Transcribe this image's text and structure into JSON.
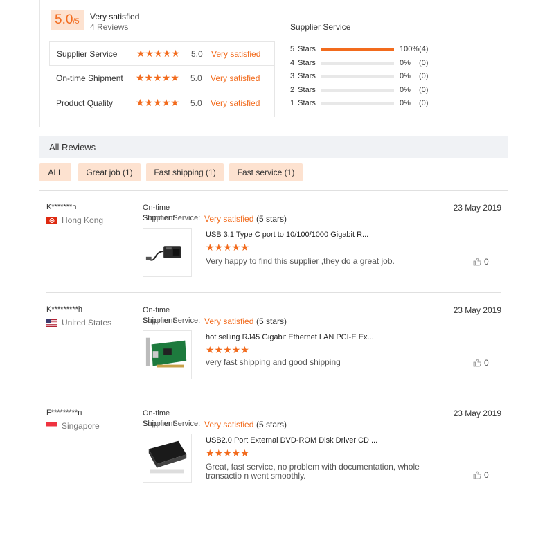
{
  "summary": {
    "score": "5.0",
    "score_max": "/5",
    "label": "Very satisfied",
    "count": "4 Reviews",
    "ratings": [
      {
        "name": "Supplier Service",
        "stars": "★★★★★",
        "value": "5.0",
        "word": "Very satisfied"
      },
      {
        "name": "On-time Shipment",
        "stars": "★★★★★",
        "value": "5.0",
        "word": "Very satisfied"
      },
      {
        "name": "Product Quality",
        "stars": "★★★★★",
        "value": "5.0",
        "word": "Very satisfied"
      }
    ],
    "distribution_title": "Supplier Service",
    "distribution": [
      {
        "label": "5 Stars",
        "fraction": 1.0,
        "pct": "100%",
        "count": "(4)"
      },
      {
        "label": "4 Stars",
        "fraction": 0.0,
        "pct": "0%",
        "count": "(0)"
      },
      {
        "label": "3 Stars",
        "fraction": 0.0,
        "pct": "0%",
        "count": "(0)"
      },
      {
        "label": "2 Stars",
        "fraction": 0.0,
        "pct": "0%",
        "count": "(0)"
      },
      {
        "label": "1 Stars",
        "fraction": 0.0,
        "pct": "0%",
        "count": "(0)"
      }
    ]
  },
  "all_reviews_title": "All Reviews",
  "filters": [
    "ALL",
    "Great job (1)",
    "Fast shipping (1)",
    "Fast service (1)"
  ],
  "reviews": [
    {
      "name": "K*******n",
      "country": "Hong Kong",
      "category_line1": "On-time",
      "category_line2": "Shipment",
      "category_overlap": "Supplier Service:",
      "rating_word": "Very satisfied",
      "rating_stars": "(5 stars)",
      "date": "23 May 2019",
      "product": "USB 3.1 Type C port to 10/100/1000 Gigabit R...",
      "stars": "★★★★★",
      "text": "Very happy to find this supplier ,they do a great job.",
      "likes": "0"
    },
    {
      "name": "K*********h",
      "country": "United States",
      "category_line1": "On-time",
      "category_line2": "Shipment",
      "category_overlap": "Supplier Service:",
      "rating_word": "Very satisfied",
      "rating_stars": "(5 stars)",
      "date": "23 May 2019",
      "product": "hot selling RJ45 Gigabit Ethernet LAN PCI-E Ex...",
      "stars": "★★★★★",
      "text": "very fast shipping and good shipping",
      "likes": "0"
    },
    {
      "name": "F*********n",
      "country": "Singapore",
      "category_line1": "On-time",
      "category_line2": "Shipment",
      "category_overlap": "Supplier Service:",
      "rating_word": "Very satisfied",
      "rating_stars": "(5 stars)",
      "date": "23 May 2019",
      "product": "USB2.0 Port External DVD-ROM Disk Driver CD ...",
      "stars": "★★★★★",
      "text": "Great, fast service, no problem with documentation, whole transactio n went smoothly.",
      "likes": "0"
    }
  ],
  "colors": {
    "accent": "#f26b1d",
    "badge_bg": "#fde2d0",
    "header_bg": "#f0f2f5"
  }
}
